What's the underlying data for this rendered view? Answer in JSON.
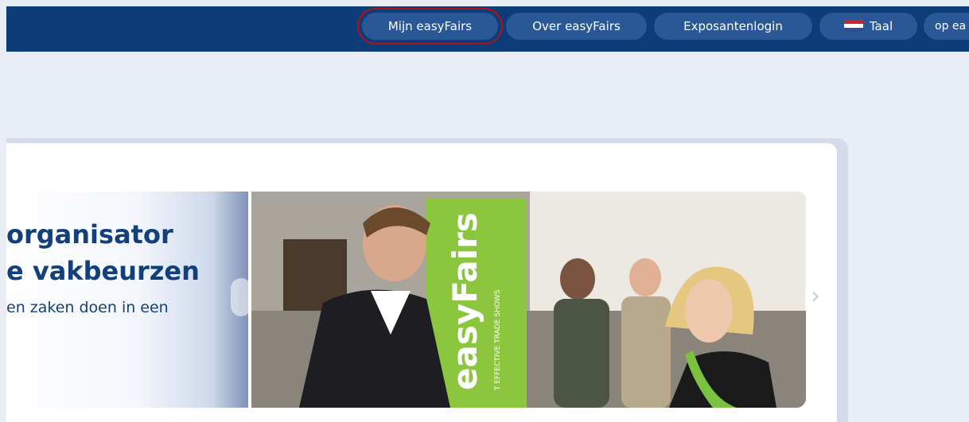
{
  "nav": {
    "items": [
      {
        "label": "Mijn easyFairs",
        "selected": true
      },
      {
        "label": "Over easyFairs"
      },
      {
        "label": "Exposantenlogin"
      },
      {
        "label": "Taal",
        "icon": "dutch-flag-icon"
      },
      {
        "label": "op ea"
      }
    ]
  },
  "slide": {
    "title_line1": "organisator",
    "title_line2": "e vakbeurzen",
    "subtitle": "en zaken doen in een",
    "banner_brand": "easyFairs",
    "banner_tagline": "T EFFECTIVE TRADE SHOWS"
  },
  "arrows": {
    "prev": "‹",
    "next": "›"
  },
  "colors": {
    "topbar": "#0d3d78",
    "nav_button": "#2a5896",
    "selection_outline": "#b0121a",
    "title_text": "#12407c",
    "background": "#e9edf5"
  }
}
